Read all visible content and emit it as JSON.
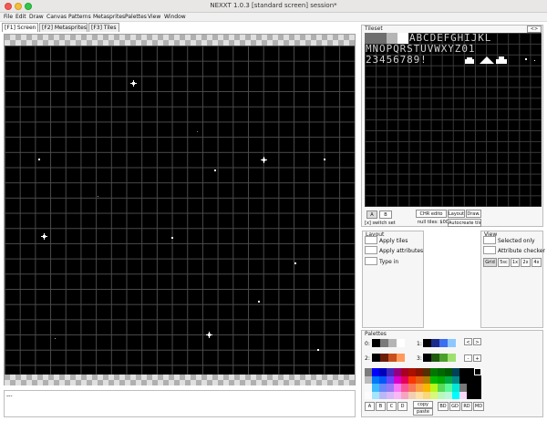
{
  "window": {
    "title": "NEXXT 1.0.3  [standard screen] session*"
  },
  "menu": [
    "File",
    "Edit",
    "Draw",
    "Canvas",
    "Patterns",
    "Metasprites",
    "Palettes",
    "View",
    "Window"
  ],
  "tabs": [
    "[F1] Screen",
    "[F2] Metasprites",
    "[F3] Tiles"
  ],
  "status": {
    "text": "---"
  },
  "tileset": {
    "label": "Tileset",
    "collapse": "<>",
    "chars_row1": "ABCDEFGHIJKL",
    "chars_row2": "MNOPQRSTUVWXYZ01",
    "chars_row3": "23456789!",
    "bank_a": "A",
    "bank_b": "B",
    "switch_set": "[x] switch set",
    "chr_edit": "CHR edito",
    "null_tiles": "null tiles: $00",
    "layout": "Layout",
    "draw": "Draw.",
    "autocreate": "Autocreate tiles"
  },
  "layout": {
    "label": "Layout",
    "apply_tiles": "Apply tiles",
    "apply_attributes": "Apply attributes",
    "type_in": "Type in"
  },
  "view": {
    "label": "View",
    "selected_only": "Selected only",
    "attribute_checker": "Attribute checker",
    "grid": "Grid",
    "grid_sizes": [
      "5sc",
      "1x",
      "2x",
      "4x"
    ]
  },
  "palettes": {
    "label": "Palettes",
    "row_labels": [
      "0:",
      "1:",
      "2:",
      "3:"
    ],
    "sub0": [
      "#000000",
      "#7a7a7a",
      "#b5b5b5",
      "#ffffff"
    ],
    "sub1": [
      "#000000",
      "#1a2a8c",
      "#3c6ef0",
      "#8cc8ff"
    ],
    "sub2": [
      "#000000",
      "#6b1d08",
      "#c8501c",
      "#ff9a5c"
    ],
    "sub3": [
      "#000000",
      "#1e5a10",
      "#4aa02c",
      "#9ee070"
    ],
    "nav_buttons": [
      "<",
      ">",
      "-",
      "+"
    ],
    "bank_buttons": [
      "A",
      "B",
      "C",
      "D"
    ],
    "copy": "copy",
    "paste": "paste",
    "mode_buttons": [
      "BD",
      "GD",
      "RD",
      "MD"
    ]
  }
}
